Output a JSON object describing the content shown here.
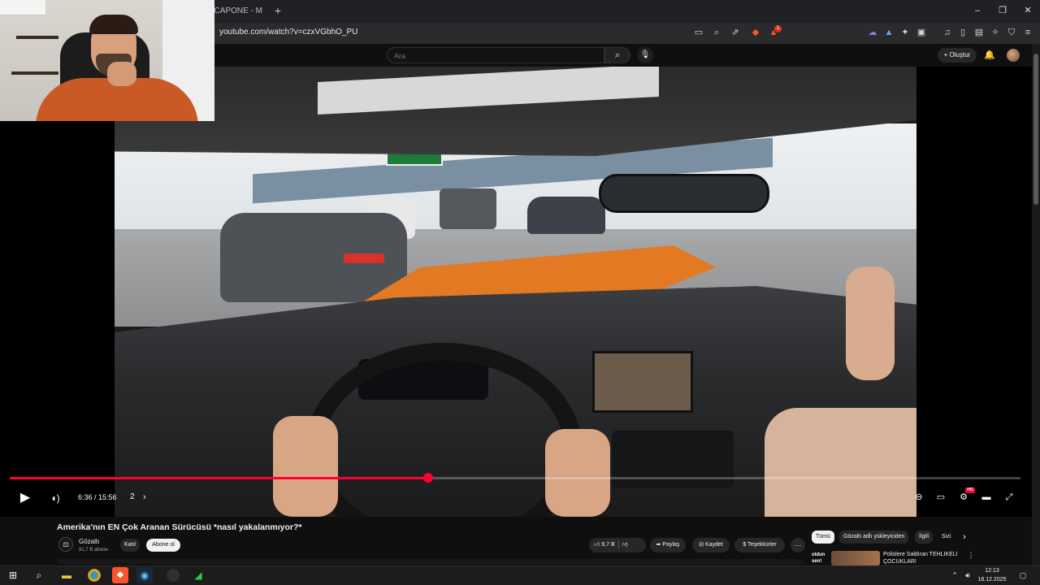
{
  "browser": {
    "tab_title": "7CAPONE - M",
    "new_tab_symbol": "+",
    "url": "youtube.com/watch?v=czxVGbhO_PU",
    "window_controls": {
      "minimize": "–",
      "restore": "❐",
      "close": "✕"
    },
    "brave_badge_count": "1"
  },
  "youtube": {
    "search_placeholder": "Ara",
    "create_label": "+ Oluştur"
  },
  "player": {
    "time": "6:36 / 15:56",
    "chapter_number": "2",
    "progress_fraction": 0.414,
    "hd_badge": "HD",
    "brand_red": "#ff0033"
  },
  "video": {
    "title": "Amerika'nın EN Çok Aranan Sürücüsü *nasıl yakalanmıyor?*",
    "channel_name": "Gözaltı",
    "subscribers": "91,7 B abone",
    "join_label": "Katıl",
    "subscribe_label": "Abone ol",
    "likes": "9,7 B",
    "share_label": "Paylaş",
    "save_label": "Kaydet",
    "thanks_label": "Teşekkürler",
    "more_label": "···"
  },
  "sidebar": {
    "chips": [
      "Tümü",
      "Gözaltı adlı yükleyiciden",
      "İlgili",
      "Sizi"
    ],
    "recommendation": {
      "thumb_text": "oldun sen!",
      "title": "Polislere Saldıran TEHLİKELİ ÇOCUKLAR!"
    }
  },
  "taskbar": {
    "time": "12:13",
    "date": "18.12.2025"
  },
  "icons": {
    "search": "search-icon",
    "mic": "mic-icon",
    "bell": "bell-icon",
    "play": "play-icon",
    "volume": "volume-icon",
    "settings": "gear-icon",
    "fullscreen": "fullscreen-icon"
  }
}
